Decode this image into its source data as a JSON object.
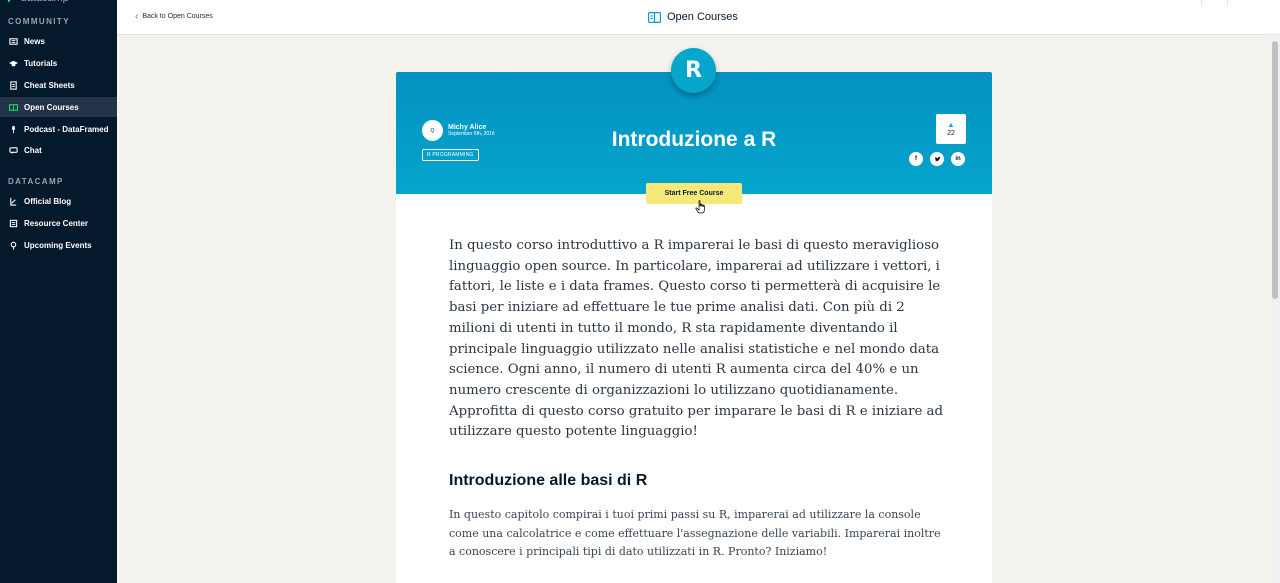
{
  "sidebar": {
    "brand": "datacamp",
    "community_title": "COMMUNITY",
    "community_items": [
      {
        "label": "News",
        "icon": "news-icon"
      },
      {
        "label": "Tutorials",
        "icon": "graduation-cap-icon"
      },
      {
        "label": "Cheat Sheets",
        "icon": "document-icon"
      },
      {
        "label": "Open Courses",
        "icon": "open-book-icon",
        "active": true
      },
      {
        "label": "Podcast - DataFramed",
        "icon": "microphone-icon"
      },
      {
        "label": "Chat",
        "icon": "chat-bubble-icon"
      }
    ],
    "datacamp_title": "DATACAMP",
    "datacamp_items": [
      {
        "label": "Official Blog",
        "icon": "blog-icon"
      },
      {
        "label": "Resource Center",
        "icon": "resource-icon"
      },
      {
        "label": "Upcoming Events",
        "icon": "location-pin-icon"
      }
    ]
  },
  "topbar": {
    "back_label": "Back to Open Courses",
    "title": "Open Courses"
  },
  "course": {
    "badge_letter": "R",
    "author_name": "Michy Alice",
    "author_date": "September 6th, 2016",
    "avatar_text": "Q",
    "tag": "R PROGRAMMING",
    "title": "Introduzione a R",
    "votes": "22",
    "socials": [
      "f",
      "t",
      "in"
    ],
    "start_button": "Start Free Course"
  },
  "body": {
    "intro": "In questo corso introduttivo a R imparerai le basi di questo meraviglioso linguaggio open source. In particolare, imparerai ad utilizzare i vettori, i fattori, le liste e i data frames. Questo corso ti permetterà di acquisire le basi per iniziare ad effettuare le tue prime analisi dati. Con più di 2 milioni di utenti in tutto il mondo, R sta rapidamente diventando il principale linguaggio utilizzato nelle analisi statistiche e nel mondo data science. Ogni anno, il numero di utenti R aumenta circa del 40% e un numero crescente di organizzazioni lo utilizzano quotidianamente. Approfitta di questo corso gratuito per imparare le basi di R e iniziare ad utilizzare questo potente linguaggio!",
    "section_heading": "Introduzione alle basi di R",
    "section_text": "In questo capitolo compirai i tuoi primi passi su R, imparerai ad utilizzare la console come una calcolatrice e come effettuare l'assegnazione delle variabili. Imparerai inoltre a conoscere i principali tipi di dato utilizzati in R. Pronto? Iniziamo!"
  },
  "colors": {
    "sidebar_bg": "#05192d",
    "hero_bg": "#05a5cc",
    "button_bg": "#f7e87a",
    "page_bg": "#f4f2ec"
  }
}
